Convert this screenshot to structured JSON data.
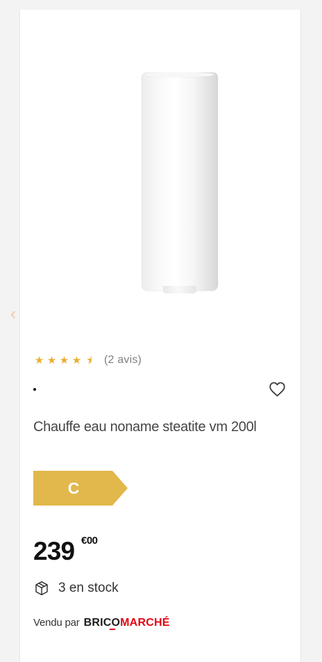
{
  "product_card": {
    "carousel_prev_symbol": "‹",
    "image": {
      "icon": "water-heater-product-image",
      "colors": {
        "body": "#f4f4f4",
        "shadow": "#d7d7d7"
      }
    },
    "rating": {
      "score": 4.5,
      "max": 5,
      "full_star": "★",
      "half_star": "⯨",
      "review_count": "(2 avis)",
      "color": "#e9ae2f"
    },
    "dot": "·",
    "wishlist": {
      "icon": "heart-outline-icon"
    },
    "title": "Chauffe eau noname steatite vm 200l",
    "energy_class": {
      "label": "C",
      "color": "#e2b84d"
    },
    "price": {
      "main": "239",
      "cents": "€00"
    },
    "stock": {
      "icon": "package-box-icon",
      "text": "3 en stock"
    },
    "seller": {
      "prefix": "Vendu par",
      "brand_part_1": "BRICO",
      "brand_part_2": "MARCHÉ",
      "brand_color_1": "#1d1d1d",
      "brand_color_2": "#e20613"
    }
  }
}
